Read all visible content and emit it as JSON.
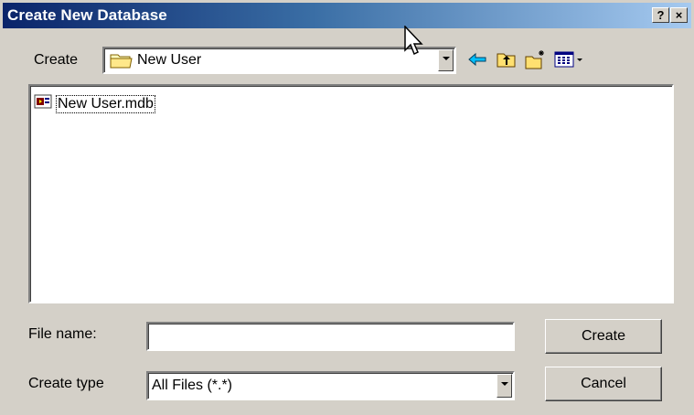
{
  "dialog": {
    "title": "Create New Database",
    "help_label": "?",
    "close_label": "×"
  },
  "location": {
    "label": "Create",
    "current_folder": "New User"
  },
  "toolbar": {
    "icons": [
      "back-arrow-icon",
      "up-one-level-icon",
      "create-new-folder-icon",
      "view-menu-icon"
    ]
  },
  "files": [
    {
      "name": "New User.mdb",
      "icon": "access-database-icon"
    }
  ],
  "filename": {
    "label": "File name:",
    "value": ""
  },
  "filetype": {
    "label": "Create type",
    "selected": "All Files (*.*)"
  },
  "buttons": {
    "create": "Create",
    "cancel": "Cancel"
  }
}
